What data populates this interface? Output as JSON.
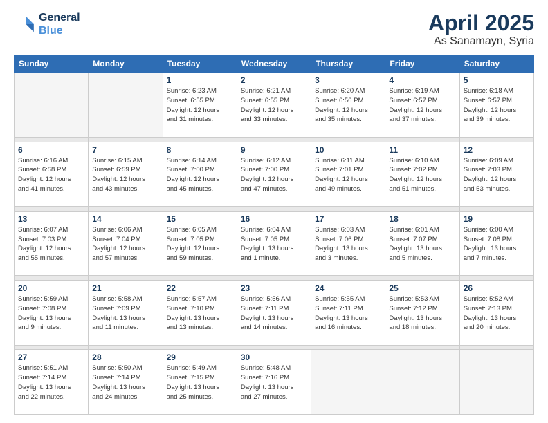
{
  "header": {
    "logo_line1": "General",
    "logo_line2": "Blue",
    "main_title": "April 2025",
    "sub_title": "As Sanamayn, Syria"
  },
  "days_of_week": [
    "Sunday",
    "Monday",
    "Tuesday",
    "Wednesday",
    "Thursday",
    "Friday",
    "Saturday"
  ],
  "weeks": [
    {
      "days": [
        {
          "num": "",
          "empty": true
        },
        {
          "num": "",
          "empty": true
        },
        {
          "num": "1",
          "detail": "Sunrise: 6:23 AM\nSunset: 6:55 PM\nDaylight: 12 hours\nand 31 minutes."
        },
        {
          "num": "2",
          "detail": "Sunrise: 6:21 AM\nSunset: 6:55 PM\nDaylight: 12 hours\nand 33 minutes."
        },
        {
          "num": "3",
          "detail": "Sunrise: 6:20 AM\nSunset: 6:56 PM\nDaylight: 12 hours\nand 35 minutes."
        },
        {
          "num": "4",
          "detail": "Sunrise: 6:19 AM\nSunset: 6:57 PM\nDaylight: 12 hours\nand 37 minutes."
        },
        {
          "num": "5",
          "detail": "Sunrise: 6:18 AM\nSunset: 6:57 PM\nDaylight: 12 hours\nand 39 minutes."
        }
      ]
    },
    {
      "days": [
        {
          "num": "6",
          "detail": "Sunrise: 6:16 AM\nSunset: 6:58 PM\nDaylight: 12 hours\nand 41 minutes."
        },
        {
          "num": "7",
          "detail": "Sunrise: 6:15 AM\nSunset: 6:59 PM\nDaylight: 12 hours\nand 43 minutes."
        },
        {
          "num": "8",
          "detail": "Sunrise: 6:14 AM\nSunset: 7:00 PM\nDaylight: 12 hours\nand 45 minutes."
        },
        {
          "num": "9",
          "detail": "Sunrise: 6:12 AM\nSunset: 7:00 PM\nDaylight: 12 hours\nand 47 minutes."
        },
        {
          "num": "10",
          "detail": "Sunrise: 6:11 AM\nSunset: 7:01 PM\nDaylight: 12 hours\nand 49 minutes."
        },
        {
          "num": "11",
          "detail": "Sunrise: 6:10 AM\nSunset: 7:02 PM\nDaylight: 12 hours\nand 51 minutes."
        },
        {
          "num": "12",
          "detail": "Sunrise: 6:09 AM\nSunset: 7:03 PM\nDaylight: 12 hours\nand 53 minutes."
        }
      ]
    },
    {
      "days": [
        {
          "num": "13",
          "detail": "Sunrise: 6:07 AM\nSunset: 7:03 PM\nDaylight: 12 hours\nand 55 minutes."
        },
        {
          "num": "14",
          "detail": "Sunrise: 6:06 AM\nSunset: 7:04 PM\nDaylight: 12 hours\nand 57 minutes."
        },
        {
          "num": "15",
          "detail": "Sunrise: 6:05 AM\nSunset: 7:05 PM\nDaylight: 12 hours\nand 59 minutes."
        },
        {
          "num": "16",
          "detail": "Sunrise: 6:04 AM\nSunset: 7:05 PM\nDaylight: 13 hours\nand 1 minute."
        },
        {
          "num": "17",
          "detail": "Sunrise: 6:03 AM\nSunset: 7:06 PM\nDaylight: 13 hours\nand 3 minutes."
        },
        {
          "num": "18",
          "detail": "Sunrise: 6:01 AM\nSunset: 7:07 PM\nDaylight: 13 hours\nand 5 minutes."
        },
        {
          "num": "19",
          "detail": "Sunrise: 6:00 AM\nSunset: 7:08 PM\nDaylight: 13 hours\nand 7 minutes."
        }
      ]
    },
    {
      "days": [
        {
          "num": "20",
          "detail": "Sunrise: 5:59 AM\nSunset: 7:08 PM\nDaylight: 13 hours\nand 9 minutes."
        },
        {
          "num": "21",
          "detail": "Sunrise: 5:58 AM\nSunset: 7:09 PM\nDaylight: 13 hours\nand 11 minutes."
        },
        {
          "num": "22",
          "detail": "Sunrise: 5:57 AM\nSunset: 7:10 PM\nDaylight: 13 hours\nand 13 minutes."
        },
        {
          "num": "23",
          "detail": "Sunrise: 5:56 AM\nSunset: 7:11 PM\nDaylight: 13 hours\nand 14 minutes."
        },
        {
          "num": "24",
          "detail": "Sunrise: 5:55 AM\nSunset: 7:11 PM\nDaylight: 13 hours\nand 16 minutes."
        },
        {
          "num": "25",
          "detail": "Sunrise: 5:53 AM\nSunset: 7:12 PM\nDaylight: 13 hours\nand 18 minutes."
        },
        {
          "num": "26",
          "detail": "Sunrise: 5:52 AM\nSunset: 7:13 PM\nDaylight: 13 hours\nand 20 minutes."
        }
      ]
    },
    {
      "days": [
        {
          "num": "27",
          "detail": "Sunrise: 5:51 AM\nSunset: 7:14 PM\nDaylight: 13 hours\nand 22 minutes."
        },
        {
          "num": "28",
          "detail": "Sunrise: 5:50 AM\nSunset: 7:14 PM\nDaylight: 13 hours\nand 24 minutes."
        },
        {
          "num": "29",
          "detail": "Sunrise: 5:49 AM\nSunset: 7:15 PM\nDaylight: 13 hours\nand 25 minutes."
        },
        {
          "num": "30",
          "detail": "Sunrise: 5:48 AM\nSunset: 7:16 PM\nDaylight: 13 hours\nand 27 minutes."
        },
        {
          "num": "",
          "empty": true
        },
        {
          "num": "",
          "empty": true
        },
        {
          "num": "",
          "empty": true
        }
      ]
    }
  ]
}
